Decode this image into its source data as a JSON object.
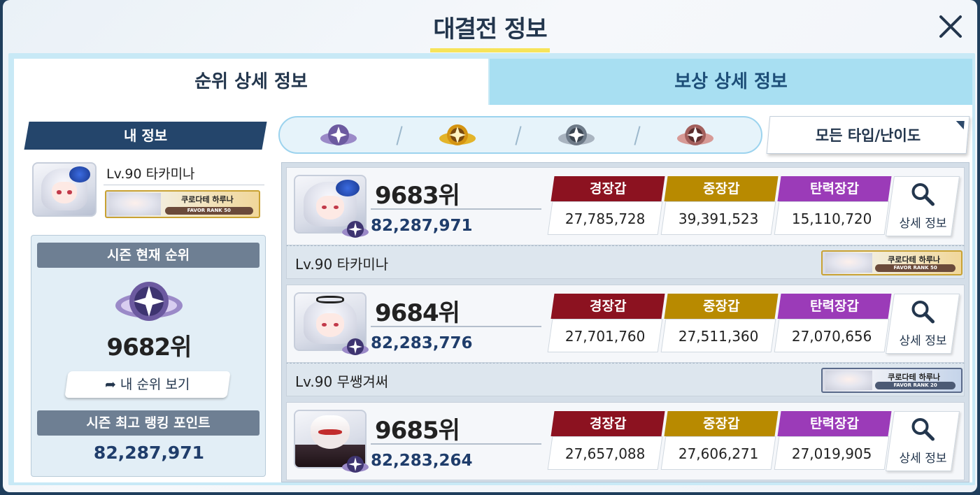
{
  "title": "대결전 정보",
  "tabs": {
    "ranking": "순위 상세 정보",
    "rewards": "보상 상세 정보"
  },
  "my_info": {
    "header": "내 정보",
    "level_name": "Lv.90 타카미나",
    "favor_name": "쿠로다테 하루나",
    "favor_rank": "FAVOR RANK 50"
  },
  "season": {
    "current_rank_label": "시즌 현재 순위",
    "current_rank": "9682위",
    "my_rank_button": "내 순위 보기",
    "best_points_label": "시즌 최고 랭킹 포인트",
    "best_points": "82,287,971"
  },
  "filter": {
    "tiers": [
      "insane-tier-icon",
      "gold-tier-icon",
      "silver-tier-icon",
      "bronze-tier-icon"
    ],
    "dropdown": "모든 타입/난이도"
  },
  "stat_labels": {
    "light": "경장갑",
    "heavy": "중장갑",
    "special": "탄력장갑"
  },
  "stat_colors": {
    "light": "#8c1220",
    "heavy": "#b88a00",
    "special": "#9b3bb8"
  },
  "detail_label": "상세 정보",
  "entries": [
    {
      "rank": "9683위",
      "score": "82,287,971",
      "light": "27,785,728",
      "heavy": "39,391,523",
      "special": "15,110,720",
      "level_name": "Lv.90  타카미나",
      "favor_name": "쿠로다테 하루나",
      "favor_rank": "FAVOR RANK 50"
    },
    {
      "rank": "9684위",
      "score": "82,283,776",
      "light": "27,701,760",
      "heavy": "27,511,360",
      "special": "27,070,656",
      "level_name": "Lv.90  무쌩겨써",
      "favor_name": "쿠로다테 하루나",
      "favor_rank": "FAVOR RANK 20"
    },
    {
      "rank": "9685위",
      "score": "82,283,264",
      "light": "27,657,088",
      "heavy": "27,606,271",
      "special": "27,019,905"
    }
  ]
}
